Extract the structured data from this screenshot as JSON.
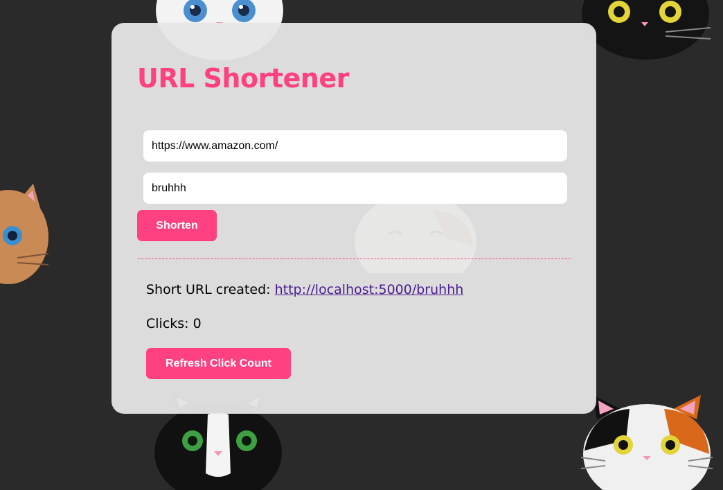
{
  "app": {
    "title": "URL Shortener"
  },
  "form": {
    "url_value": "https://www.amazon.com/",
    "alias_value": "bruhhh",
    "shorten_label": "Shorten"
  },
  "result": {
    "created_label": "Short URL created:",
    "short_url": "http://localhost:5000/bruhhh",
    "clicks_label": "Clicks:",
    "clicks_value": "0",
    "refresh_label": "Refresh Click Count"
  },
  "colors": {
    "accent": "#ff4081",
    "background": "#2a2a2a",
    "card": "#e6e6e6",
    "link": "#4b1d8f"
  },
  "background_icons": [
    "white-cat-face-icon",
    "black-cat-face-icon",
    "orange-cat-face-icon",
    "calico-cat-face-icon",
    "tuxedo-cat-face-icon",
    "calico-cat-face-icon"
  ]
}
